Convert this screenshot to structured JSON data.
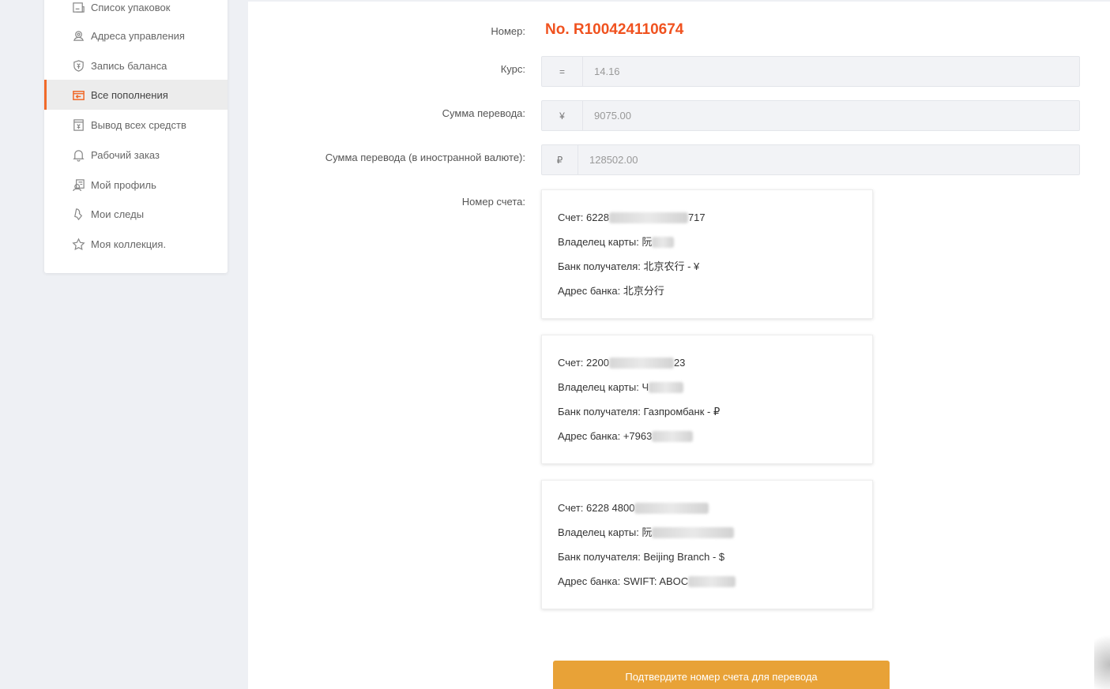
{
  "sidebar": {
    "items": [
      {
        "label": "Список упаковок",
        "icon": "package-list-icon"
      },
      {
        "label": "Адреса управления",
        "icon": "address-icon"
      },
      {
        "label": "Запись баланса",
        "icon": "balance-icon"
      },
      {
        "label": "Все пополнения",
        "icon": "recharge-icon",
        "active": true
      },
      {
        "label": "Вывод всех средств",
        "icon": "withdraw-icon"
      },
      {
        "label": "Рабочий заказ",
        "icon": "bell-icon"
      },
      {
        "label": "Мой профиль",
        "icon": "profile-icon"
      },
      {
        "label": "Мои следы",
        "icon": "footprint-icon"
      },
      {
        "label": "Моя коллекция.",
        "icon": "star-icon"
      }
    ]
  },
  "form": {
    "number_label": "Номер:",
    "number_value": "No. R100424110674",
    "rate_label": "Курс:",
    "rate_addon": "=",
    "rate_value": "14.16",
    "amount_label": "Сумма перевода:",
    "amount_addon": "¥",
    "amount_value": "9075.00",
    "foreign_label": "Сумма перевода (в иностранной валюте):",
    "foreign_addon": "₽",
    "foreign_value": "128502.00",
    "account_label": "Номер счета:"
  },
  "accounts": [
    {
      "account_key": "Счет:",
      "account_visible_start": "6228",
      "account_visible_end": "717",
      "holder_key": "Владелец карты:",
      "holder_visible": "阮",
      "bank_key": "Банк получателя:",
      "bank_value": "北京农行 - ¥",
      "address_key": "Адрес банка:",
      "address_value": "北京分行"
    },
    {
      "account_key": "Счет:",
      "account_visible_start": "2200",
      "account_visible_end": "23",
      "holder_key": "Владелец карты:",
      "holder_visible": "Ч",
      "bank_key": "Банк получателя:",
      "bank_value": "Газпромбанк - ₽",
      "address_key": "Адрес банка:",
      "address_value": "+7963"
    },
    {
      "account_key": "Счет:",
      "account_visible_start": "6228 4800",
      "account_visible_end": "",
      "holder_key": "Владелец карты:",
      "holder_visible": "阮",
      "bank_key": "Банк получателя:",
      "bank_value": "Beijing Branch - $",
      "address_key": "Адрес банка:",
      "address_value": "SWIFT: ABOC"
    }
  ],
  "confirm_button": "Подтвердите номер счета для перевода",
  "colors": {
    "accent": "#f0521f",
    "button": "#e8a237",
    "active_bar": "#f06a2a"
  }
}
